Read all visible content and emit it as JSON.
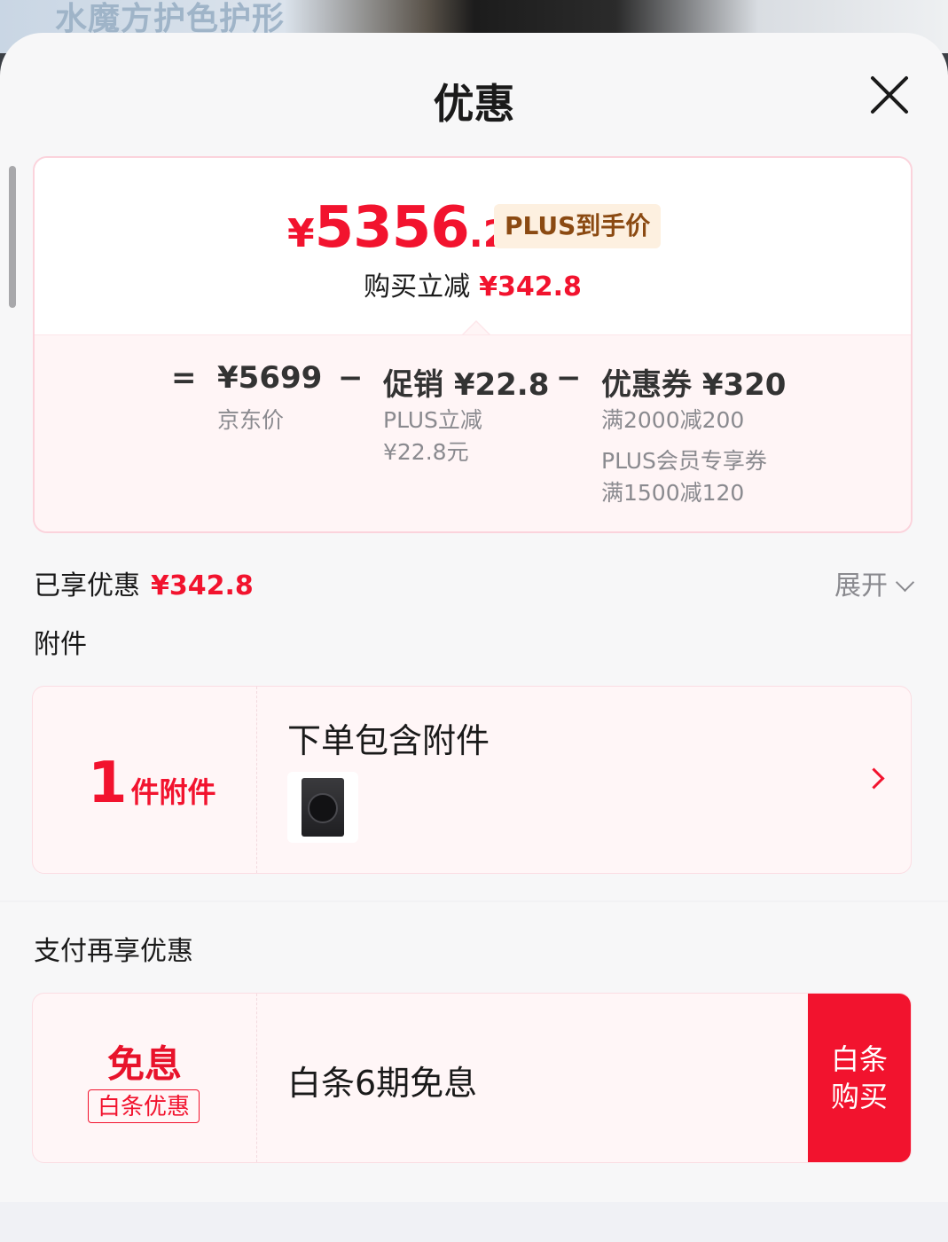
{
  "background": {
    "banner_text": "水魔方护色护形"
  },
  "sheet": {
    "title": "优惠"
  },
  "price": {
    "currency": "¥",
    "integer": "5356",
    "decimal": ".2",
    "tag": "PLUS到手价",
    "reduce_label": "购买立减",
    "reduce_amount": "¥342.8"
  },
  "formula": {
    "equals": "=",
    "minus": "−",
    "jd_price": {
      "value": "¥5699",
      "label": "京东价"
    },
    "promotion": {
      "value": "促销 ¥22.8",
      "details": [
        "PLUS立减",
        "¥22.8元"
      ]
    },
    "coupon": {
      "value": "优惠券 ¥320",
      "details": [
        "满2000减200",
        "PLUS会员专享券",
        "满1500减120"
      ]
    }
  },
  "enjoyed": {
    "label": "已享优惠",
    "amount": "¥342.8",
    "expand_label": "展开"
  },
  "accessories": {
    "section_title": "附件",
    "count": "1",
    "unit": "件附件",
    "title": "下单包含附件"
  },
  "payment": {
    "section_title": "支付再享优惠",
    "badge_title": "免息",
    "badge_tag": "白条优惠",
    "text": "白条6期免息",
    "button_line1": "白条",
    "button_line2": "购买"
  },
  "colors": {
    "accent": "#f2132e",
    "tag_bg": "#fdf0e0",
    "tag_text": "#8b4a12"
  }
}
